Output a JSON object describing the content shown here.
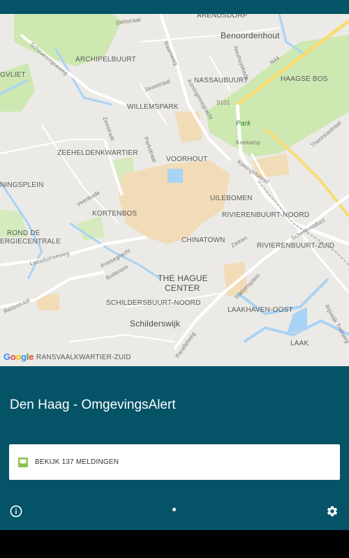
{
  "map": {
    "neighbourhoods": [
      "ARENDSDORP",
      "Benoordenhout",
      "ARCHIPELBUURT",
      "NASSAUBUURT",
      "HAAGSE BOS",
      "WILLEMSPARK",
      "ZEEHELDENKWARTIER",
      "VOORHOUT",
      "UILEBOMEN",
      "KORTENBOS",
      "RIVIERENBUURT-NOORD",
      "CHINATOWN",
      "RIVIERENBUURT-ZUID",
      "ROND DE",
      "ERGIECENTRALE",
      "THE HAGUE",
      "CENTER",
      "SCHILDERSBUURT-NOORD",
      "LAAKHAVEN-OOST",
      "Schilderswijk",
      "LAAK",
      "RANSVAALKWARTIER-ZUID",
      "NINGSPLEIN",
      "GVLIET"
    ],
    "streets": [
      "Delistraat",
      "Scheveningseweg",
      "Neuhuyskade",
      "Raamweg",
      "Javastraat",
      "Koninginnegracht",
      "N44",
      "S101",
      "Zeestraat",
      "Parkstraat",
      "Theresiastraat",
      "Koekamp",
      "Koningstunnel",
      "Veenkade",
      "Schenkviaduct",
      "Zieken",
      "Prinsegracht",
      "Loosduinseweg",
      "Buitenom",
      "Stationsplein",
      "Reitzstraat",
      "Parallelweg",
      "Rijswijk Trekweg"
    ],
    "park_label": "Park",
    "attribution": [
      "G",
      "o",
      "o",
      "g",
      "l",
      "e"
    ]
  },
  "app": {
    "title": "Den Haag - OmgevingsAlert"
  },
  "alerts": {
    "button_label": "BEKIJK 137 MELDINGEN",
    "icon": "inbox-icon",
    "icon_color": "#8bc34a"
  },
  "footer": {
    "info_icon": "info-icon",
    "settings_icon": "gear-icon"
  },
  "colors": {
    "background": "#045367",
    "map_base": "#eceae6",
    "park": "#cde8b1",
    "water": "#a9d3f5",
    "highlight": "#f2dcb8"
  }
}
